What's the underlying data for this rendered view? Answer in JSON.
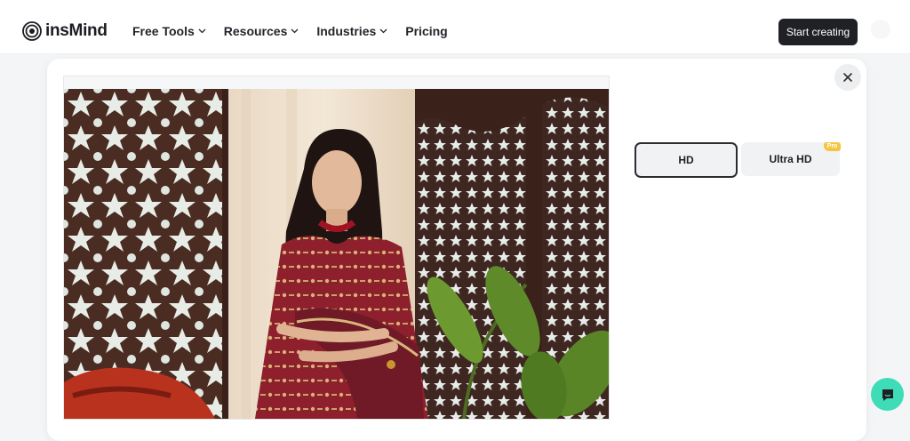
{
  "header": {
    "brand": "insMind",
    "nav": [
      {
        "label": "Free Tools",
        "has_dropdown": true
      },
      {
        "label": "Resources",
        "has_dropdown": true
      },
      {
        "label": "Industries",
        "has_dropdown": true
      },
      {
        "label": "Pricing",
        "has_dropdown": false
      }
    ],
    "cta_label": "Start creating"
  },
  "modal": {
    "options": [
      {
        "label": "HD",
        "selected": true
      },
      {
        "label": "Ultra HD",
        "selected": false,
        "badge": "Pro"
      }
    ]
  },
  "icons": {
    "logo": "insmind-logo-icon",
    "close": "close-icon",
    "chat": "chat-icon",
    "dropdown": "chevron-down-icon"
  },
  "colors": {
    "cta_bg": "#1f2125",
    "pro_badge": "#f4c542",
    "chat_bg": "#3fdcb8",
    "garment": "#8e1f2c"
  }
}
